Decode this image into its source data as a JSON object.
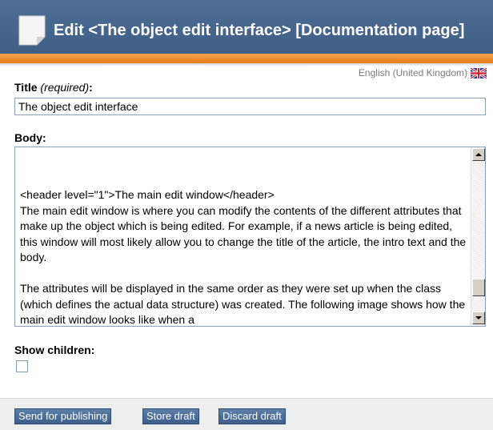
{
  "header": {
    "title": "Edit <The object edit interface> [Documentation page]"
  },
  "language": {
    "label": "English (United Kingdom)",
    "flag_icon": "uk-flag-icon"
  },
  "fields": {
    "title": {
      "label": "Title",
      "required_note": "(required)",
      "colon": ":",
      "value": "The object edit interface"
    },
    "body": {
      "label": "Body:",
      "text": "<header level=\"1\">The main edit window</header>\nThe main edit window is where you can modify the contents of the different attributes that make up the object which is being edited. For example, if a news article is being edited, this window will most likely allow you to change the title of the article, the intro text and the body.\n\nThe attributes will be displayed in the same order as they were set up when the class (which defines the actual data structure) was created. The following image shows how the main edit window looks like when a"
    },
    "show_children": {
      "label": "Show children:",
      "checked": false
    }
  },
  "buttons": {
    "send": "Send for publishing",
    "store": "Store draft",
    "discard": "Discard draft"
  },
  "colors": {
    "header_blue": "#3e5c84",
    "header_orange": "#e87f19",
    "button_blue": "#4a6d97"
  }
}
